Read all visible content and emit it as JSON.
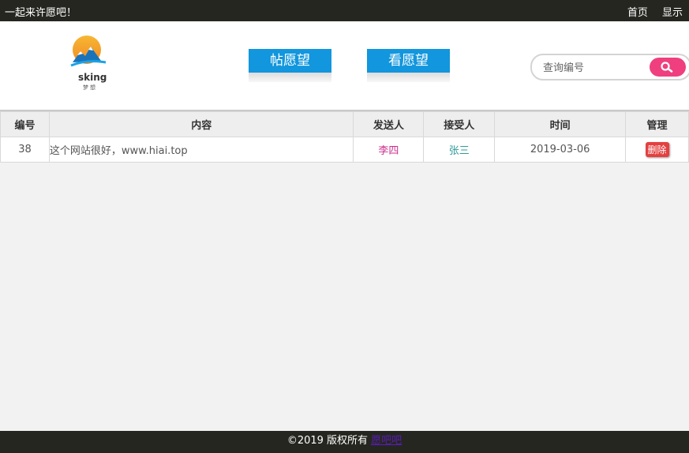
{
  "topbar": {
    "slogan": "一起来许愿吧！",
    "nav": [
      "首页",
      "显示"
    ]
  },
  "logo": {
    "text": "sking",
    "sub": "梦想"
  },
  "tabs": {
    "post_label": "帖愿望",
    "view_label": "看愿望"
  },
  "search": {
    "placeholder": "查询编号"
  },
  "table": {
    "headers": [
      "编号",
      "内容",
      "发送人",
      "接受人",
      "时间",
      "管理"
    ],
    "rows": [
      {
        "id": "38",
        "content": "这个网站很好，www.hiai.top",
        "sender": "李四",
        "receiver": "张三",
        "date": "2019-03-06",
        "action": "删除"
      }
    ]
  },
  "footer": {
    "copyright": "©2019 版权所有",
    "link": "愿吧吧"
  },
  "colors": {
    "topbar": "#262621",
    "tab_blue": "#1296dd",
    "search_button": "#ef3f7f",
    "sender": "#cc2e8c",
    "receiver": "#2f9b98",
    "delete": "#e44040"
  }
}
